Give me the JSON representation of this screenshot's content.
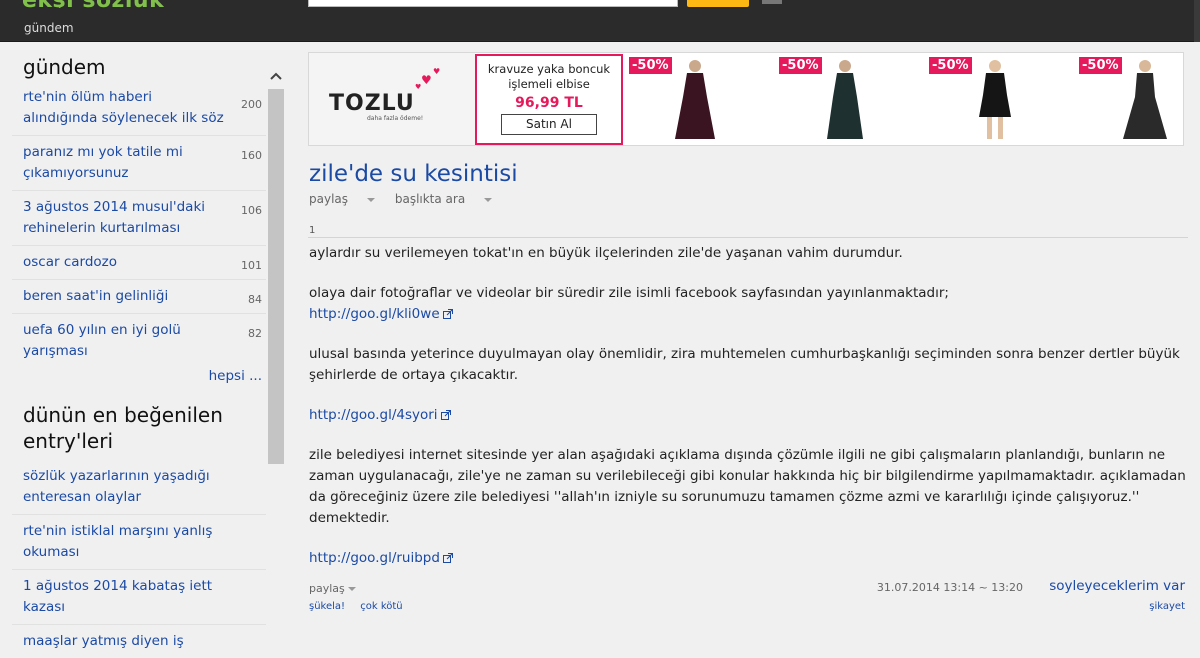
{
  "topbar": {
    "logo_text": "ekşi sözlük",
    "nav_label": "gündem"
  },
  "sidebar": {
    "heading": "gündem",
    "items": [
      {
        "title": "rte'nin ölüm haberi alındığında söylenecek ilk söz",
        "count": "200"
      },
      {
        "title": "paranız mı yok tatile mi çıkamıyorsunuz",
        "count": "160"
      },
      {
        "title": "3 ağustos 2014 musul'daki rehinelerin kurtarılması",
        "count": "106"
      },
      {
        "title": "oscar cardozo",
        "count": "101"
      },
      {
        "title": "beren saat'in gelinliği",
        "count": "84"
      },
      {
        "title": "uefa 60 yılın en iyi golü yarışması",
        "count": "82"
      }
    ],
    "more_label": "hepsi ...",
    "heading2": "dünün en beğenilen entry'leri",
    "liked": [
      {
        "title": "sözlük yazarlarının yaşadığı enteresan olaylar"
      },
      {
        "title": "rte'nin istiklal marşını yanlış okuması"
      },
      {
        "title": "1 ağustos 2014 kabataş iett kazası"
      },
      {
        "title": "maaşlar yatmış diyen iş"
      }
    ],
    "scroll_up_icon": "chevron-up-icon"
  },
  "ad": {
    "brand": "TOZLU",
    "tagline": "daha fazla ödeme!",
    "offer_desc": "kravuze yaka boncuk işlemeli elbise",
    "offer_price": "96,99 TL",
    "buy_label": "Satın Al",
    "products": [
      {
        "badge": "-50%",
        "color": "#3a1420"
      },
      {
        "badge": "-50%",
        "color": "#1e3030"
      },
      {
        "badge": "-50%",
        "color": "#151515"
      },
      {
        "badge": "-50%",
        "color": "#2a2a2a"
      }
    ],
    "accent": "#e6195c"
  },
  "topic": {
    "title": "zile'de su kesintisi",
    "share_label": "paylaş",
    "search_in_title_label": "başlıkta ara"
  },
  "entry": {
    "number": "1",
    "paragraphs": [
      "aylardır su verilemeyen tokat'ın en büyük ilçelerinden zile'de yaşanan vahim durumdur.",
      "olaya dair fotoğraflar ve videolar bir süredir zile isimli facebook sayfasından yayınlanmaktadır;",
      "ulusal basında yeterince duyulmayan olay önemlidir, zira muhtemelen cumhurbaşkanlığı seçiminden sonra benzer dertler büyük şehirlerde de ortaya çıkacaktır.",
      "zile belediyesi internet sitesinde yer alan aşağıdaki açıklama dışında çözümle ilgili ne gibi çalışmaların planlandığı, bunların ne zaman uygulanacağı, zile'ye ne zaman su verilebileceği gibi konular hakkında hiç bir bilgilendirme yapılmamaktadır. açıklamadan da göreceğiniz üzere zile belediyesi ''allah'ın izniyle su sorunumuzu tamamen çözme azmi ve kararlılığı içinde çalışıyoruz.'' demektedir."
    ],
    "links": [
      "http://goo.gl/kli0we",
      "http://goo.gl/4syori",
      "http://goo.gl/ruibpd"
    ],
    "share_label": "paylaş",
    "date": "31.07.2014 13:14 ~ 13:20",
    "author": "soyleyeceklerim var",
    "vote_up": "şükela!",
    "vote_down": "çok kötü",
    "report": "şikayet"
  },
  "colors": {
    "link": "#1b4aa4",
    "topbar_bg": "#2b2b2b",
    "search_button": "#fdb813",
    "logo_green": "#81c14b"
  }
}
